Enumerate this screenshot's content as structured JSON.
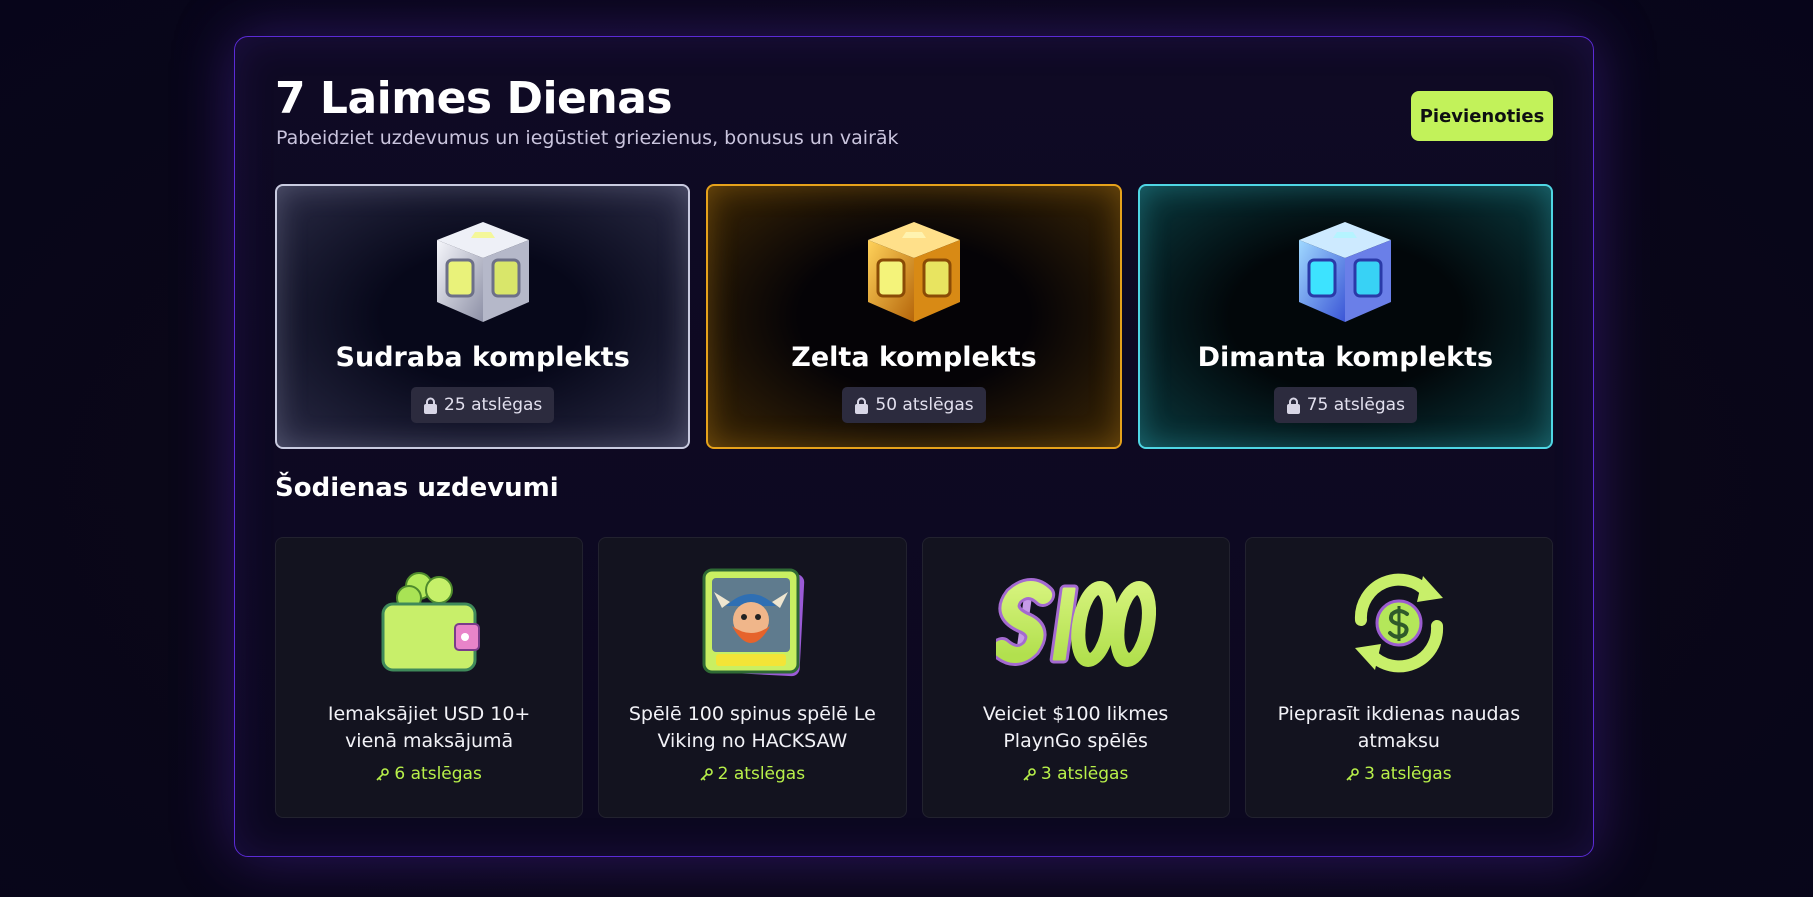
{
  "header": {
    "title": "7 Laimes Dienas",
    "subtitle": "Pabeidziet uzdevumus un iegūstiet griezienus, bonusus un vairāk",
    "join_label": "Pievienoties"
  },
  "packs": [
    {
      "name": "Sudraba komplekts",
      "keys": "25 atslēgas",
      "icon": "silver-cube-icon",
      "color": "#c9cbe0"
    },
    {
      "name": "Zelta komplekts",
      "keys": "50 atslēgas",
      "icon": "gold-cube-icon",
      "color": "#e6a21b"
    },
    {
      "name": "Dimanta komplekts",
      "keys": "75 atslēgas",
      "icon": "diamond-cube-icon",
      "color": "#4fd6e4"
    }
  ],
  "tasks_section": {
    "title": "Šodienas uzdevumi",
    "tasks": [
      {
        "text": "Iemaksājiet USD 10+ vienā maksājumā",
        "reward": "6 atslēgas",
        "icon": "wallet-coins-icon"
      },
      {
        "text": "Spēlē 100 spinus spēlē Le Viking no HACKSAW",
        "reward": "2 atslēgas",
        "icon": "le-viking-game-icon"
      },
      {
        "text": "Veiciet $100 likmes PlaynGo spēlēs",
        "reward": "3 atslēgas",
        "icon": "dollar-100-icon"
      },
      {
        "text": "Pieprasīt ikdienas naudas atmaksu",
        "reward": "3 atslēgas",
        "icon": "cashback-icon"
      }
    ]
  },
  "colors": {
    "accent": "#c2f25a",
    "reward_text": "#b8f04a",
    "panel_border": "#5b2bd6"
  }
}
